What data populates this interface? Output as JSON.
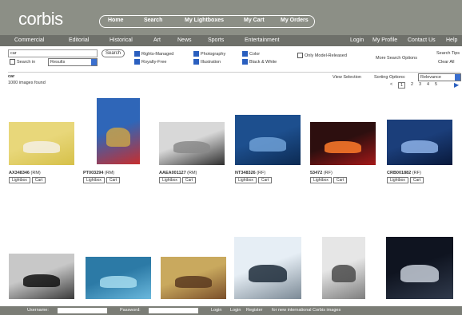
{
  "brand": {
    "logo": "corbis"
  },
  "topnav": {
    "items": [
      "Home",
      "Search",
      "My Lightboxes",
      "My Cart",
      "My Orders"
    ]
  },
  "catnav": {
    "left": [
      "Commercial",
      "Editorial",
      "Historical",
      "Art",
      "News",
      "Sports",
      "Entertainment"
    ],
    "right": [
      "Login",
      "My Profile",
      "Contact Us",
      "Help"
    ]
  },
  "search": {
    "query": "car",
    "search_button": "Search",
    "search_in_label": "Search in",
    "search_in_value": "Results",
    "license": [
      "Rights-Managed",
      "Royalty-Free"
    ],
    "type": [
      "Photography",
      "Illustration"
    ],
    "color": [
      "Color",
      "Black & White"
    ],
    "restrict": "Only Model-Released",
    "tips_link": "Search Tips",
    "more_options_link": "More Search Options",
    "clear_link": "Clear All"
  },
  "results": {
    "term": "car",
    "count_text": "1000 images found",
    "view_link": "View Selection",
    "sort_label": "Sorting Options:",
    "sort_value": "Relevance",
    "pager": [
      "1",
      "2",
      "3",
      "4",
      "5"
    ],
    "pager_prefix": "<",
    "pager_next": "▶"
  },
  "images": [
    {
      "id": "AX348346",
      "lic": "(RM)",
      "bg1": "#e8d77a",
      "bg2": "#d6c049",
      "fg": "#f4f0e4"
    },
    {
      "id": "PT003294",
      "lic": "(RM)",
      "bg1": "#2f66b8",
      "bg2": "#c72e2e",
      "fg": "#c8a24a"
    },
    {
      "id": "AAEA001127",
      "lic": "(RM)",
      "bg1": "#d8d8d8",
      "bg2": "#2e2e2e",
      "fg": "#8a8a8a"
    },
    {
      "id": "NT348326",
      "lic": "(RF)",
      "bg1": "#1d4f8e",
      "bg2": "#0c2a52",
      "fg": "#6fa0d6"
    },
    {
      "id": "53472",
      "lic": "(RF)",
      "bg1": "#2d0f0f",
      "bg2": "#a41818",
      "fg": "#ff7b2a"
    },
    {
      "id": "CRB001882",
      "lic": "(RF)",
      "bg1": "#1b3e7a",
      "bg2": "#09193b",
      "fg": "#8db2e8"
    },
    {
      "id": "",
      "lic": "",
      "bg1": "#c8c8c8",
      "bg2": "#3a3a3a",
      "fg": "#111111"
    },
    {
      "id": "",
      "lic": "",
      "bg1": "#2c7aa6",
      "bg2": "#6ab8dc",
      "fg": "#a6dcef"
    },
    {
      "id": "",
      "lic": "",
      "bg1": "#c9a95e",
      "bg2": "#7a4e2a",
      "fg": "#5b3a20"
    },
    {
      "id": "",
      "lic": "",
      "bg1": "#e6eef5",
      "bg2": "#7c8a96",
      "fg": "#1d2b3a"
    },
    {
      "id": "",
      "lic": "",
      "bg1": "#e6e6e6",
      "bg2": "#7e7e7e",
      "fg": "#4b4b4b"
    },
    {
      "id": "",
      "lic": "",
      "bg1": "#0f1420",
      "bg2": "#303a4c",
      "fg": "#c5ccd7"
    }
  ],
  "actions": {
    "lightbox": "Lightbox",
    "cart": "Cart"
  },
  "footer": {
    "username": "Username:",
    "password": "Password:",
    "login": "Login",
    "login_link": "Login",
    "register": "Register",
    "tail": "for new international Corbis images"
  }
}
